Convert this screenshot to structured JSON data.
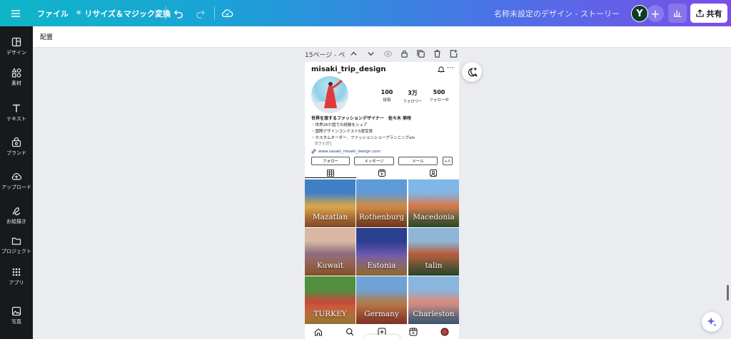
{
  "topbar": {
    "file_label": "ファイル",
    "resize_label": "リサイズ＆マジック変換",
    "doc_title": "名称未設定のデザイン - ストーリー",
    "avatar_initial": "Y",
    "share_label": "共有"
  },
  "rail": {
    "items": [
      {
        "label": "デザイン",
        "icon": "layout-icon"
      },
      {
        "label": "素材",
        "icon": "elements-icon"
      },
      {
        "label": "テキスト",
        "icon": "text-icon"
      },
      {
        "label": "ブランド",
        "icon": "brand-icon"
      },
      {
        "label": "アップロード",
        "icon": "upload-icon"
      },
      {
        "label": "お絵描き",
        "icon": "draw-icon"
      },
      {
        "label": "プロジェクト",
        "icon": "folder-icon"
      },
      {
        "label": "アプリ",
        "icon": "apps-icon"
      },
      {
        "label": "写真",
        "icon": "photo-icon"
      }
    ]
  },
  "subheader": {
    "title": "配置"
  },
  "pagebar": {
    "label": "15ページ - ペ"
  },
  "profile": {
    "username": "misaki_trip_design",
    "stats": [
      {
        "number": "100",
        "label": "投稿"
      },
      {
        "number": "3万",
        "label": "フォロワー"
      },
      {
        "number": "500",
        "label": "フォロー中"
      }
    ],
    "bio_name": "世界を旅するファッションデザイナー　佐々木 美咲",
    "bio_lines": [
      "・世界26か国での経験をシェア",
      "・国際デザインコンテスト5度受賞",
      "・カスタムオーダー、ファッションショープランニングetc"
    ],
    "bio_more": "続きを読む",
    "link": "www.sasaki_misaki_design.com",
    "buttons": [
      "フォロー",
      "メッセージ",
      "メール"
    ]
  },
  "grid": {
    "tiles": [
      {
        "caption": "Mazatlan",
        "colors": [
          "#3f7fc6",
          "#d6a64a",
          "#c46a3a"
        ]
      },
      {
        "caption": "Rothenburg",
        "colors": [
          "#5f9ad8",
          "#cf8a45",
          "#a4532d"
        ]
      },
      {
        "caption": "Macedonia",
        "colors": [
          "#7fb7e6",
          "#d7784d",
          "#3f6d3e"
        ]
      },
      {
        "caption": "Kuwait",
        "colors": [
          "#d8b8a4",
          "#8a6a7a",
          "#c97a3e"
        ]
      },
      {
        "caption": "Estonia",
        "colors": [
          "#2b3f8f",
          "#6a55b0",
          "#d59b4a"
        ]
      },
      {
        "caption": "talin",
        "colors": [
          "#8fb6d6",
          "#b55a3c",
          "#3f6a3c"
        ]
      },
      {
        "caption": "TURKEY",
        "colors": [
          "#4f8f3f",
          "#c9473a",
          "#e0b34a"
        ]
      },
      {
        "caption": "Germany",
        "colors": [
          "#6fa3d8",
          "#b07a4a",
          "#c24a3a"
        ]
      },
      {
        "caption": "Charleston",
        "colors": [
          "#8ab5de",
          "#d98a7a",
          "#5a7fa8"
        ]
      }
    ]
  }
}
